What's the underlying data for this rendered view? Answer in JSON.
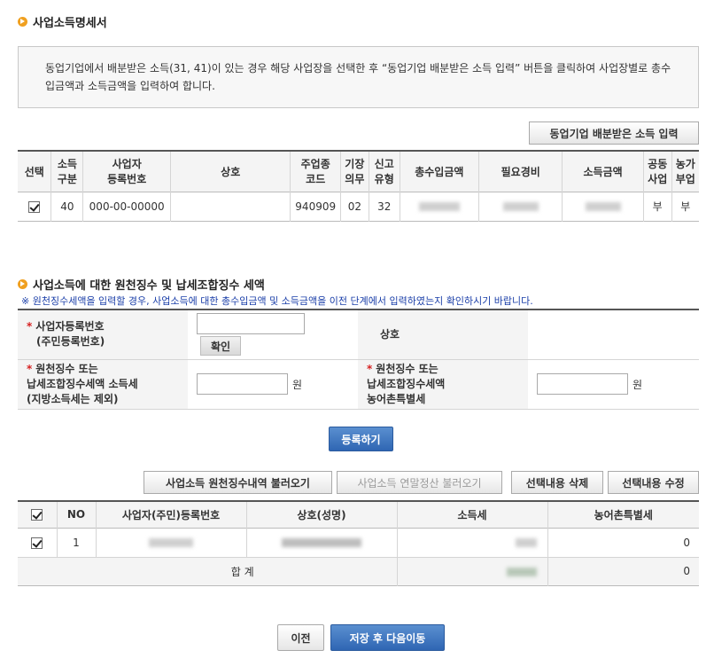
{
  "section1": {
    "title": "사업소득명세서",
    "notice": "동업기업에서 배분받은 소득(31, 41)이 있는 경우 해당 사업장을 선택한 후 “동업기업 배분받은 소득 입력” 버튼을 클릭하여 사업장별로 총수입금액과 소득금액을 입력하여 합니다.",
    "partner_button": "동업기업 배분받은 소득 입력",
    "headers": [
      "선택",
      "소득\n구분",
      "사업자\n등록번호",
      "상호",
      "주업종\n코드",
      "기장\n의무",
      "신고\n유형",
      "총수입금액",
      "필요경비",
      "소득금액",
      "공동\n사업",
      "농가\n부업"
    ],
    "row": {
      "income_type": "40",
      "biz_no": "000-00-00000",
      "trade_name": "",
      "industry_code": "940909",
      "bookkeeping": "02",
      "report_type": "32",
      "joint": "부",
      "farm": "부"
    }
  },
  "section2": {
    "title": "사업소득에 대한 원천징수 및 납세조합징수 세액",
    "note": "※ 원천징수세액을 입력할 경우, 사업소득에 대한 총수입금액 및 소득금액을 이전 단계에서 입력하였는지 확인하시기 바랍니다.",
    "biz_no_label_1": "사업자등록번호",
    "biz_no_label_2": "(주민등록번호)",
    "confirm_button": "확인",
    "trade_name_label": "상호",
    "withholding_label_1": "원천징수 또는",
    "withholding_label_2": "납세조합징수세액 소득세",
    "withholding_label_3": "(지방소득세는 제외)",
    "rural_label_1": "원천징수 또는",
    "rural_label_2": "납세조합징수세액",
    "rural_label_3": "농어촌특별세",
    "unit_won": "원",
    "register_button": "등록하기"
  },
  "actions": {
    "load_withholding": "사업소득 원천징수내역 불러오기",
    "load_yearend": "사업소득 연말정산 불러오기",
    "delete_selected": "선택내용 삭제",
    "edit_selected": "선택내용 수정"
  },
  "list": {
    "headers": [
      "NO",
      "사업자(주민)등록번호",
      "상호(성명)",
      "소득세",
      "농어촌특별세"
    ],
    "rows": [
      {
        "no": "1",
        "rural_tax": "0"
      }
    ],
    "total_label": "합 계",
    "total_rural_tax": "0"
  },
  "footer": {
    "prev_button": "이전",
    "save_next_button": "저장 후 다음이동"
  },
  "colors": {
    "accent_bullet": "#f0a020",
    "primary_button": "#2f66b3",
    "note_text": "#1a3ea8"
  }
}
